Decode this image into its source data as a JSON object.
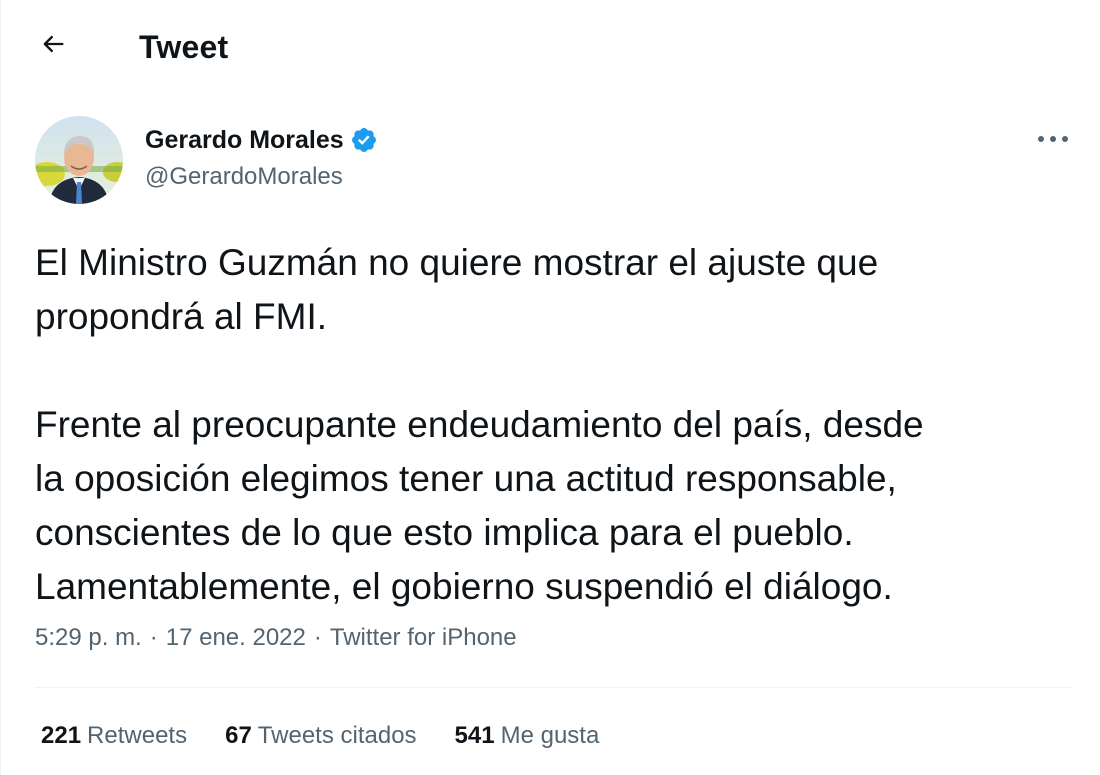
{
  "header": {
    "title": "Tweet",
    "back_icon": "arrow-left-icon"
  },
  "author": {
    "name": "Gerardo Morales",
    "handle": "@GerardoMorales",
    "verified": true,
    "verified_icon": "verified-badge-icon",
    "avatar_icon": "avatar-photo"
  },
  "more_icon": "more-horizontal-icon",
  "tweet": {
    "paragraphs": [
      {
        "lines": [
          "El Ministro Guzmán no quiere mostrar el ajuste que",
          "propondrá al FMI."
        ]
      },
      {
        "lines": [
          "Frente al preocupante endeudamiento del país, desde",
          "la oposición elegimos tener una actitud responsable,",
          "conscientes de lo que esto implica para el pueblo.",
          "Lamentablemente, el gobierno suspendió el diálogo."
        ]
      }
    ]
  },
  "meta": {
    "time": "5:29 p. m.",
    "separator": "·",
    "date": "17 ene. 2022",
    "source": "Twitter for iPhone"
  },
  "stats": {
    "retweets_count": "221",
    "retweets_label": "Retweets",
    "quotes_count": "67",
    "quotes_label": "Tweets citados",
    "likes_count": "541",
    "likes_label": "Me gusta"
  },
  "colors": {
    "text": "#0f1419",
    "secondary": "#536471",
    "verified": "#1d9bf0",
    "divider": "#eff3f4"
  }
}
